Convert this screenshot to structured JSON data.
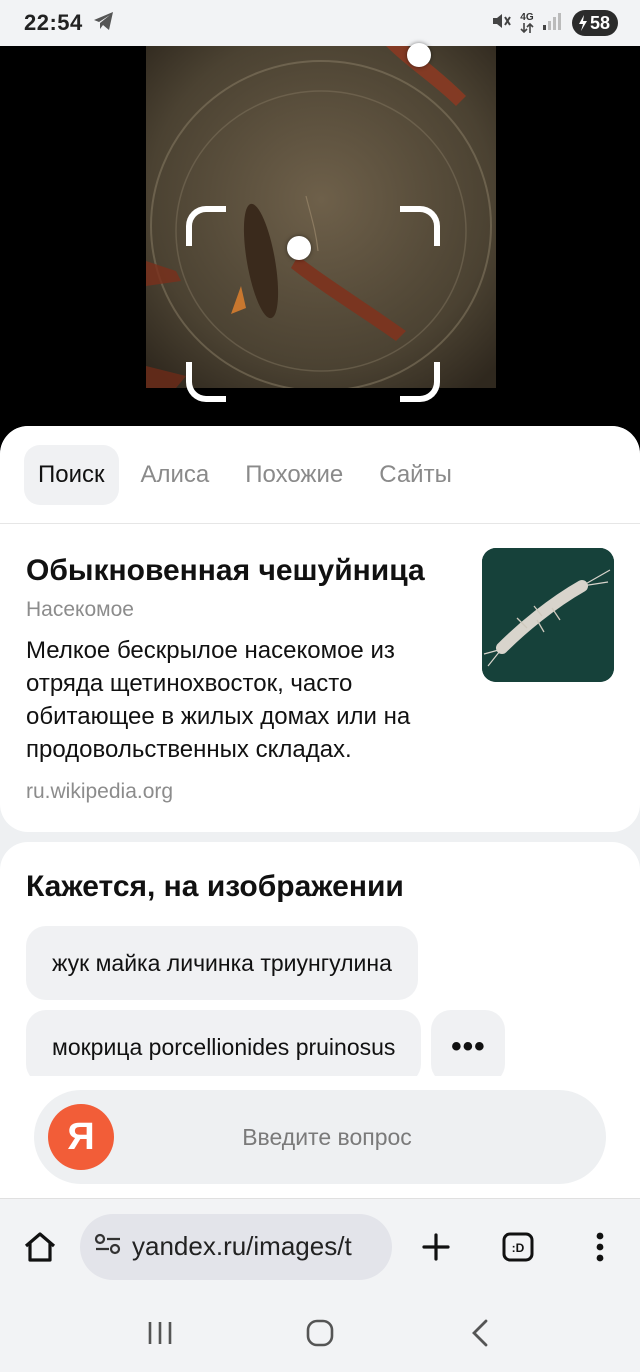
{
  "status_bar": {
    "time": "22:54",
    "network": "4G",
    "battery": "58"
  },
  "tabs": [
    {
      "label": "Поиск",
      "active": true
    },
    {
      "label": "Алиса",
      "active": false
    },
    {
      "label": "Похожие",
      "active": false
    },
    {
      "label": "Сайты",
      "active": false
    }
  ],
  "entity": {
    "title": "Обыкновенная чешуйница",
    "type": "Насекомое",
    "description": "Мелкое бескрылое насекомое из отряда щетинохвосток, часто обитающее в жилых домах или на продовольственных складах.",
    "source": "ru.wikipedia.org"
  },
  "recognized": {
    "title": "Кажется, на изображении",
    "chips": [
      "жук майка личинка триунгулина",
      "мокрица porcellionides pruinosus"
    ],
    "more_label": "•••"
  },
  "query": {
    "logo": "Я",
    "placeholder": "Введите вопрос"
  },
  "browser": {
    "url": "yandex.ru/images/t"
  },
  "colors": {
    "accent": "#f25d38",
    "sheet_bg": "#eef0f2"
  }
}
